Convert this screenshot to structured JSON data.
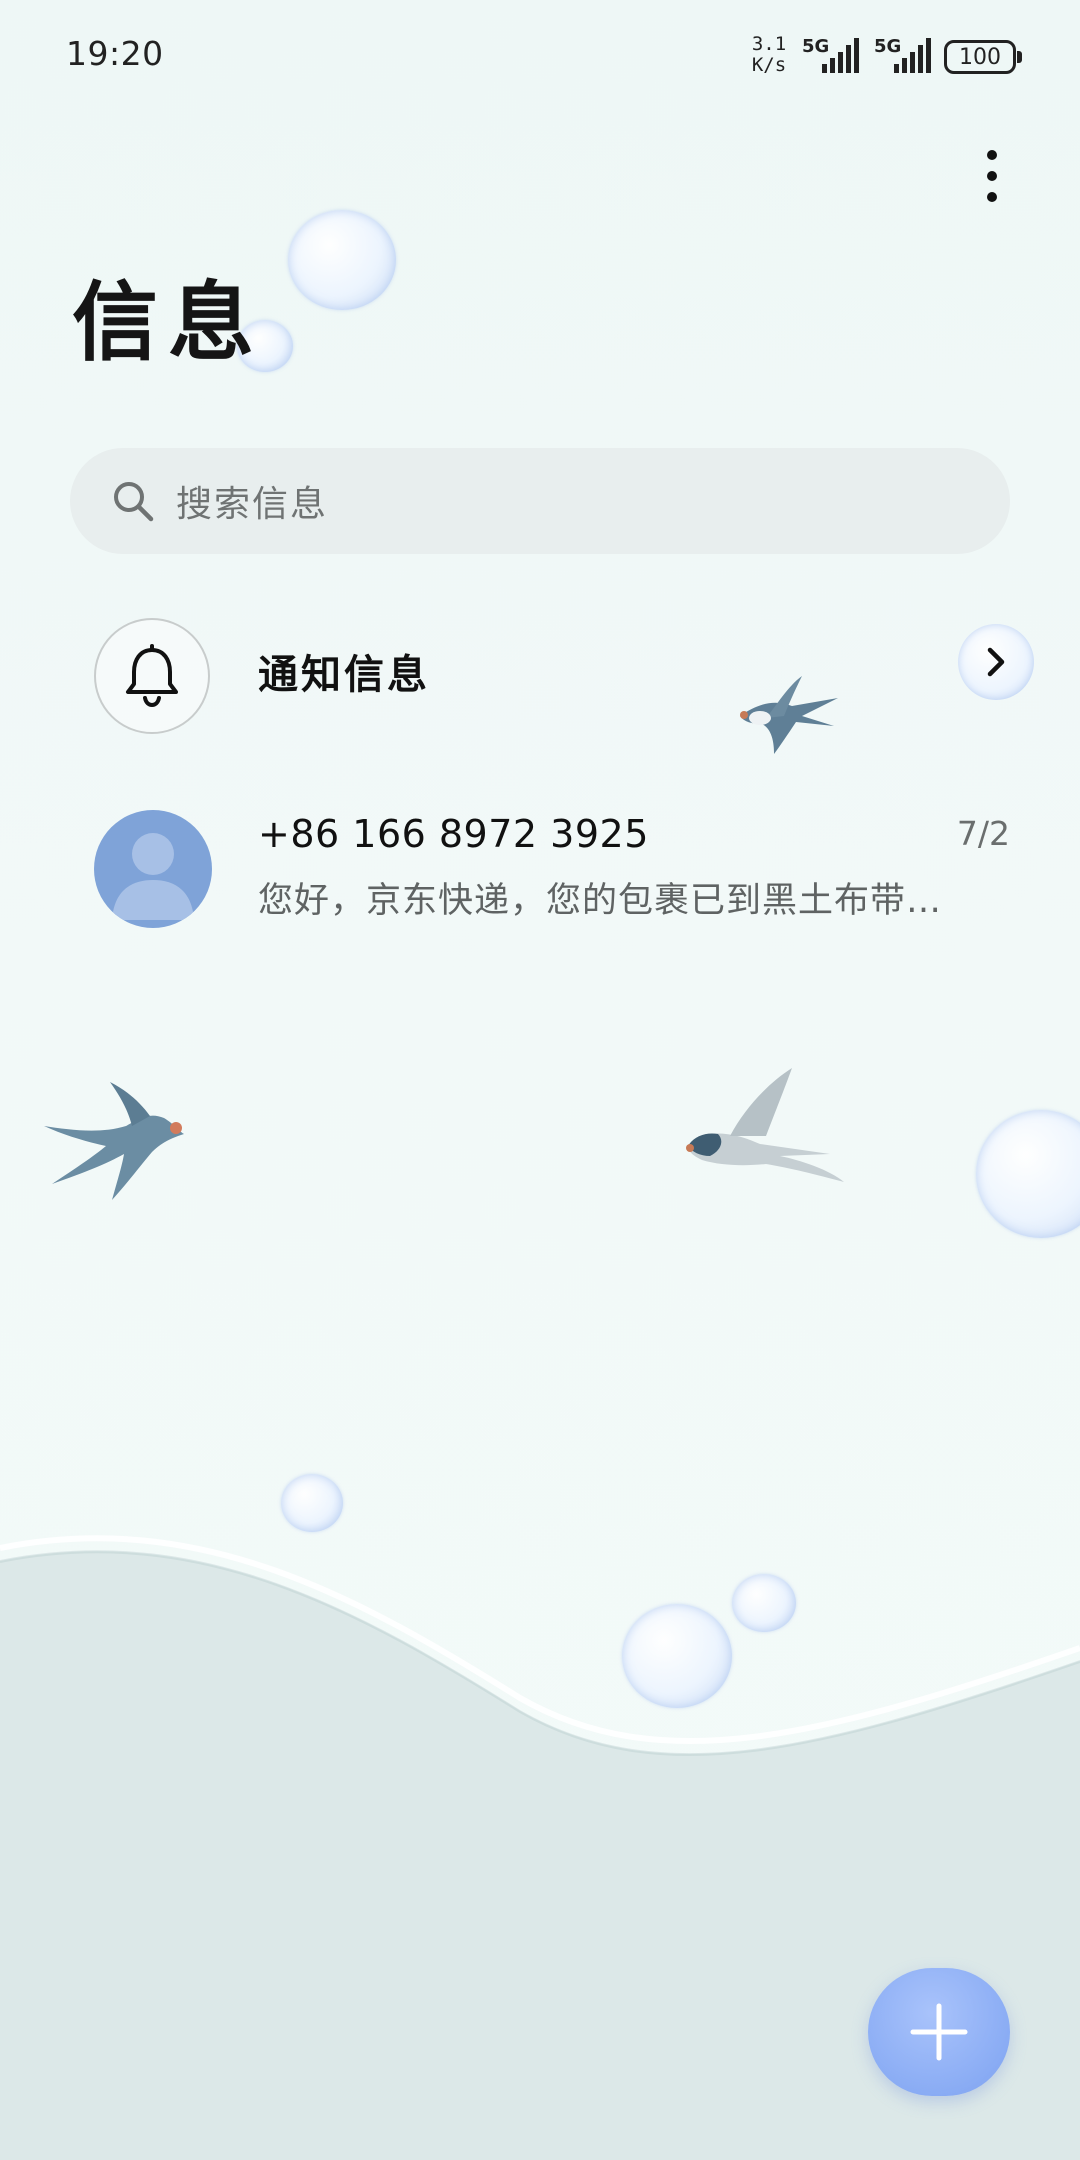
{
  "status_bar": {
    "time": "19:20",
    "net_speed_value": "3.1",
    "net_speed_unit": "K/s",
    "sim1_label": "5G",
    "sim2_label": "5G",
    "battery": "100"
  },
  "header": {
    "title": "信息",
    "more_icon": "more-vertical-icon"
  },
  "search": {
    "placeholder": "搜索信息",
    "icon": "search-icon"
  },
  "notification_entry": {
    "label": "通知信息",
    "icon": "bell-icon",
    "chevron_icon": "chevron-right-icon"
  },
  "conversations": [
    {
      "sender": "+86 166 8972 3925",
      "date": "7/2",
      "preview": "您好，京东快递，您的包裹已到黑土布带…",
      "avatar_icon": "person-icon"
    }
  ],
  "fab": {
    "icon": "plus-icon"
  },
  "colors": {
    "background": "#eef7f6",
    "wave": "#dde9e9",
    "search_bg": "#e8eeee",
    "avatar": "#7fa3d8",
    "fab": "#8aacf4"
  }
}
